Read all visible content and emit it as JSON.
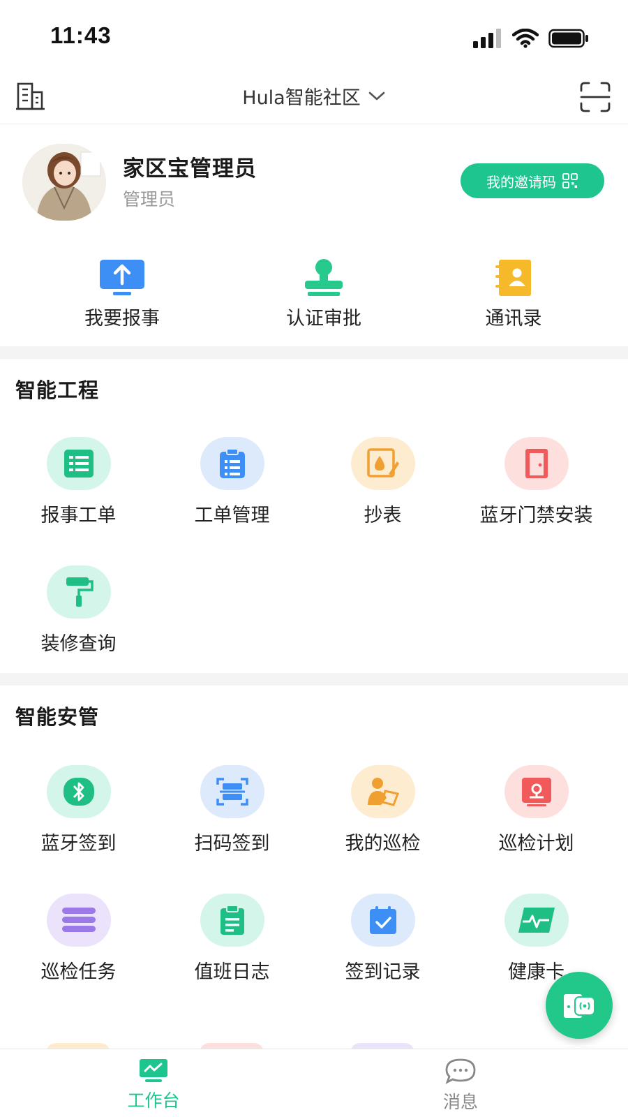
{
  "status_bar": {
    "time": "11:43"
  },
  "nav": {
    "title": "Hula智能社区"
  },
  "profile": {
    "name": "家区宝管理员",
    "role": "管理员",
    "invite_label": "我的邀请码"
  },
  "quick_actions": [
    {
      "label": "我要报事",
      "icon": "upload-report-icon"
    },
    {
      "label": "认证审批",
      "icon": "stamp-icon"
    },
    {
      "label": "通讯录",
      "icon": "contact-book-icon"
    }
  ],
  "sections": [
    {
      "title": "智能工程",
      "items": [
        {
          "label": "报事工单",
          "icon": "work-order-list-icon"
        },
        {
          "label": "工单管理",
          "icon": "clipboard-list-icon"
        },
        {
          "label": "抄表",
          "icon": "meter-reading-icon"
        },
        {
          "label": "蓝牙门禁安装",
          "icon": "door-icon"
        },
        {
          "label": "装修查询",
          "icon": "paint-roller-icon"
        }
      ]
    },
    {
      "title": "智能安管",
      "items": [
        {
          "label": "蓝牙签到",
          "icon": "bluetooth-icon"
        },
        {
          "label": "扫码签到",
          "icon": "scan-code-icon"
        },
        {
          "label": "我的巡检",
          "icon": "inspector-icon"
        },
        {
          "label": "巡检计划",
          "icon": "location-plan-icon"
        },
        {
          "label": "巡检任务",
          "icon": "task-layers-icon"
        },
        {
          "label": "值班日志",
          "icon": "duty-log-icon"
        },
        {
          "label": "签到记录",
          "icon": "calendar-check-icon"
        },
        {
          "label": "健康卡",
          "icon": "health-card-icon"
        }
      ]
    }
  ],
  "tabs": [
    {
      "label": "工作台",
      "active": true
    },
    {
      "label": "消息",
      "active": false
    }
  ],
  "colors": {
    "accent": "#1fc58e",
    "inactive": "#888888"
  }
}
